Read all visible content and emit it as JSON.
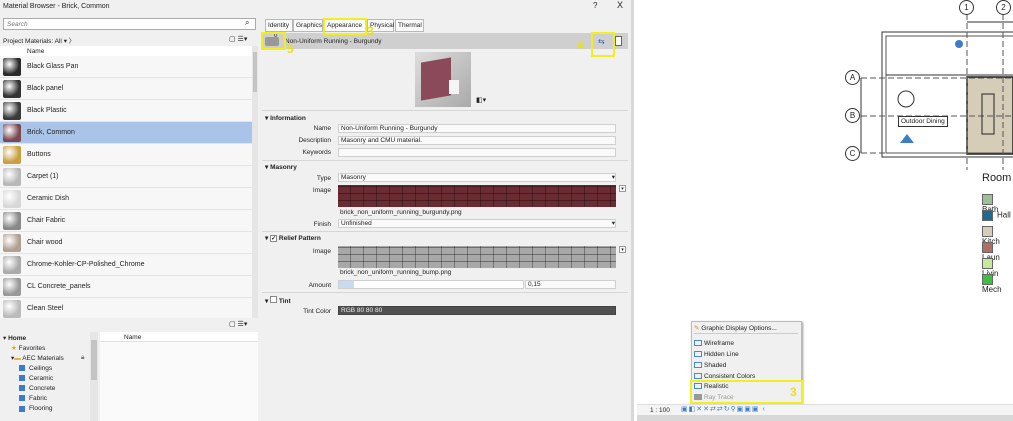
{
  "dialog": {
    "title": "Material Browser - Brick, Common",
    "help": "?",
    "close": "X"
  },
  "search": {
    "placeholder": "Search"
  },
  "filter": {
    "label": "Project Materials: All"
  },
  "list": {
    "header": "Name",
    "items": [
      {
        "name": "Black Glass Pan",
        "color": "#2a2a2a"
      },
      {
        "name": "Black panel",
        "color": "#333"
      },
      {
        "name": "Black Plastic",
        "color": "#3a3a3a"
      },
      {
        "name": "Brick, Common",
        "color": "#7a4a52",
        "selected": true
      },
      {
        "name": "Buttons",
        "color": "#c8a040"
      },
      {
        "name": "Carpet (1)",
        "color": "#b8b8b8"
      },
      {
        "name": "Ceramic Dish",
        "color": "#d8d8d8"
      },
      {
        "name": "Chair Fabric",
        "color": "#888"
      },
      {
        "name": "Chair wood",
        "color": "#b0a090"
      },
      {
        "name": "Chrome-Kohler-CP-Polished_Chrome",
        "color": "#aaa"
      },
      {
        "name": "CL Concrete_panels",
        "color": "#999"
      },
      {
        "name": "Clean Steel",
        "color": "#bbb"
      }
    ]
  },
  "library": {
    "header": "Name",
    "tree": [
      {
        "label": "Home",
        "level": 0
      },
      {
        "label": "Favorites",
        "level": 1
      },
      {
        "label": "AEC Materials",
        "level": 1
      },
      {
        "label": "Ceilings",
        "level": 2
      },
      {
        "label": "Ceramic",
        "level": 2
      },
      {
        "label": "Concrete",
        "level": 2
      },
      {
        "label": "Fabric",
        "level": 2
      },
      {
        "label": "Flooring",
        "level": 2
      }
    ]
  },
  "tabs": [
    "Identity",
    "Graphics",
    "Appearance",
    "Physical",
    "Thermal"
  ],
  "asset": {
    "count": "0",
    "name": "Non-Uniform Running - Burgundy"
  },
  "information": {
    "title": "Information",
    "name_label": "Name",
    "name": "Non-Uniform Running - Burgundy",
    "desc_label": "Description",
    "desc": "Masonry and CMU material.",
    "kw_label": "Keywords",
    "kw": ""
  },
  "masonry": {
    "title": "Masonry",
    "type_label": "Type",
    "type": "Masonry",
    "image_label": "Image",
    "image_file": "brick_non_uniform_running_burgundy.png",
    "finish_label": "Finish",
    "finish": "Unfinished"
  },
  "relief": {
    "title": "Relief Pattern",
    "checked": true,
    "image_label": "Image",
    "image_file": "brick_non_uniform_running_bump.png",
    "amount_label": "Amount",
    "amount": "0,15"
  },
  "tint": {
    "title": "Tint",
    "checked": false,
    "color_label": "Tint Color",
    "color": "RGB 80 80 80"
  },
  "annotations": [
    "3",
    "5",
    "4",
    "3"
  ],
  "plan": {
    "grid_cols": [
      "1",
      "2"
    ],
    "grid_rows": [
      "A",
      "B",
      "C"
    ],
    "room_tag": "Outdoor Dining",
    "legend_title": "Room",
    "legend": [
      {
        "name": "Bath",
        "color": "#9dbf9a"
      },
      {
        "name": "Hall",
        "color": "#1f6a94"
      },
      {
        "name": "Kitch",
        "color": "#d6cdb8"
      },
      {
        "name": "Laun",
        "color": "#b07060"
      },
      {
        "name": "Livin",
        "color": "#c8e89a"
      },
      {
        "name": "Mech",
        "color": "#3cc040"
      }
    ]
  },
  "menu": {
    "items": [
      "Graphic Display Options...",
      "Wireframe",
      "Hidden Line",
      "Shaded",
      "Consistent Colors",
      "Realistic",
      "Ray Trace"
    ]
  },
  "status": {
    "scale": "1 : 100"
  }
}
